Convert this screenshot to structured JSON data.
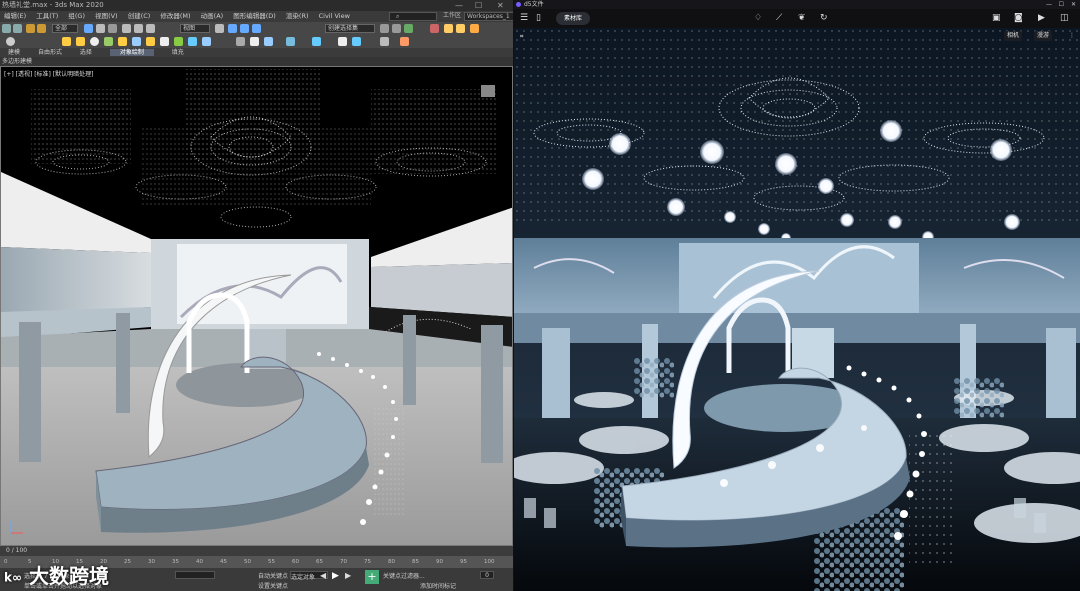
{
  "max": {
    "title": "热墙礼堂.max - 3ds Max 2020",
    "window_controls": [
      "—",
      "☐",
      "✕"
    ],
    "menu": [
      "编辑(E)",
      "工具(T)",
      "组(G)",
      "视图(V)",
      "创建(C)",
      "修改器(M)",
      "动画(A)",
      "图形编辑器(D)",
      "渲染(R)",
      "Civil View",
      "自定义(U)",
      "脚本(S)",
      "内容",
      "Arnold",
      "帮助(H)"
    ],
    "menu_fields": {
      "workspace_label": "工作区",
      "workspace_value": "Workspaces_1",
      "path_value": "C:\\Users\\...\\Max 2020"
    },
    "toolbar": {
      "select_filter": "全部",
      "view_dropdown": "视图",
      "create_sel": "创建选择集"
    },
    "ribbon": {
      "items": [
        "建模",
        "自由形式",
        "选择",
        "对象绘制",
        "填充"
      ],
      "active": "对象绘制"
    },
    "sub_ribbon": "多边形建模",
    "viewport_label": "[+] [透视] [标准] [默认明暗处理]",
    "slider": "0 / 100",
    "timeline_ticks": [
      "0",
      "5",
      "10",
      "15",
      "20",
      "25",
      "30",
      "35",
      "40",
      "45",
      "50",
      "55",
      "60",
      "65",
      "70",
      "75",
      "80",
      "85",
      "90",
      "95",
      "100"
    ],
    "status": {
      "line1": "选择了 7 个 对象",
      "line2": "单击或单击并拖动以选择对象",
      "autokey": "自动关键点",
      "setkey": "设置关键点",
      "selected": "选定对象",
      "keyfilter": "关键点过滤器...",
      "frame": "0",
      "addtime": "添加时间标记"
    }
  },
  "d5": {
    "title": "d5文件",
    "material_button": "素材库",
    "top_right": {
      "camera_label": "相机",
      "view_label": "漫游"
    },
    "toolbar_icons": [
      "menu-icon",
      "file-icon",
      "import-icon",
      "light-icon",
      "path-icon",
      "leaf-icon",
      "refresh-icon",
      "camera-icon",
      "photo-icon",
      "video-icon",
      "panorama-icon"
    ]
  },
  "watermark": "大数跨境",
  "colors": {
    "max_bg": "#444444",
    "d5_bg": "#0b0b0d",
    "accent": "#596273"
  }
}
